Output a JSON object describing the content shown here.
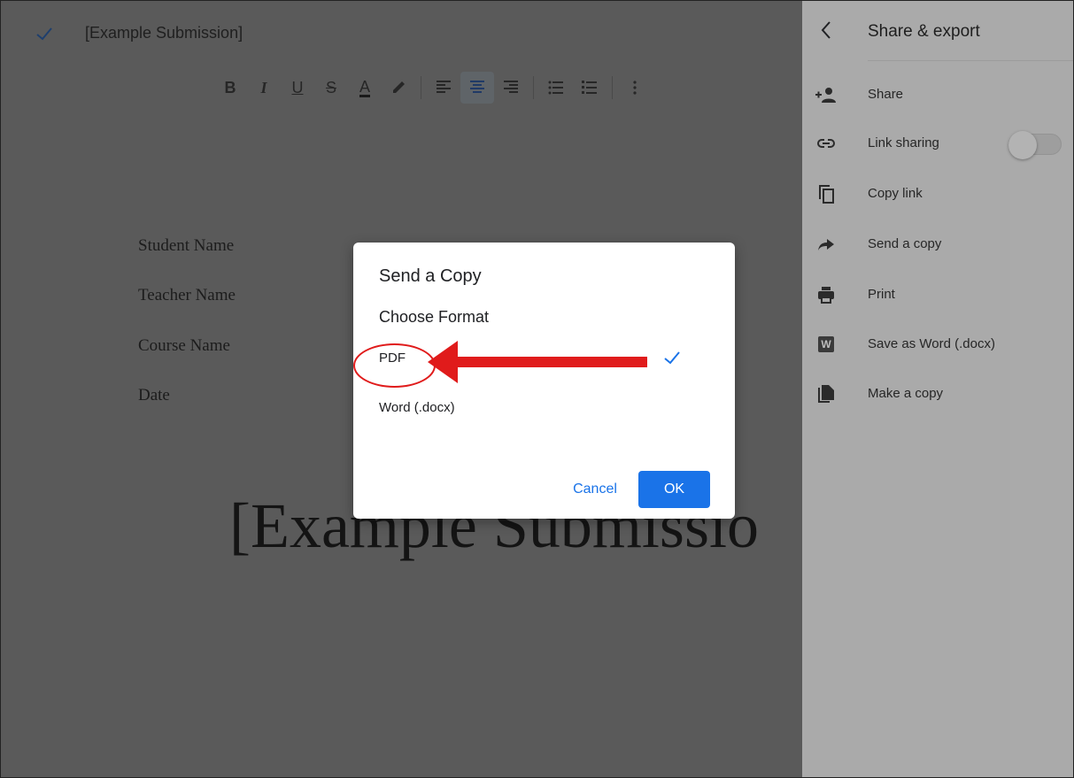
{
  "document": {
    "title": "[Example Submission]",
    "fields": [
      "Student Name",
      "Teacher Name",
      "Course Name",
      "Date"
    ],
    "big_title": "[Example Submissio"
  },
  "toolbar": {
    "bold": "B",
    "italic": "I",
    "underline": "U",
    "strikethrough": "S",
    "text_color": "A"
  },
  "panel": {
    "title": "Share & export",
    "items": [
      {
        "label": "Share",
        "icon": "add-person-icon"
      },
      {
        "label": "Link sharing",
        "icon": "link-icon"
      },
      {
        "label": "Copy link",
        "icon": "copy-icon"
      },
      {
        "label": "Send a copy",
        "icon": "send-arrow-icon"
      },
      {
        "label": "Print",
        "icon": "printer-icon"
      },
      {
        "label": "Save as Word (.docx)",
        "icon": "word-icon"
      },
      {
        "label": "Make a copy",
        "icon": "file-copy-icon"
      }
    ],
    "word_icon_letter": "W",
    "link_sharing_enabled": false
  },
  "dialog": {
    "title": "Send a Copy",
    "subtitle": "Choose Format",
    "options": [
      {
        "label": "PDF",
        "selected": true
      },
      {
        "label": "Word (.docx)",
        "selected": false
      }
    ],
    "cancel_label": "Cancel",
    "ok_label": "OK"
  },
  "colors": {
    "accent": "#1a73e8",
    "annotation": "#e01b1b",
    "overlay": "#5a5a5a",
    "panel": "#aaaaaa"
  }
}
